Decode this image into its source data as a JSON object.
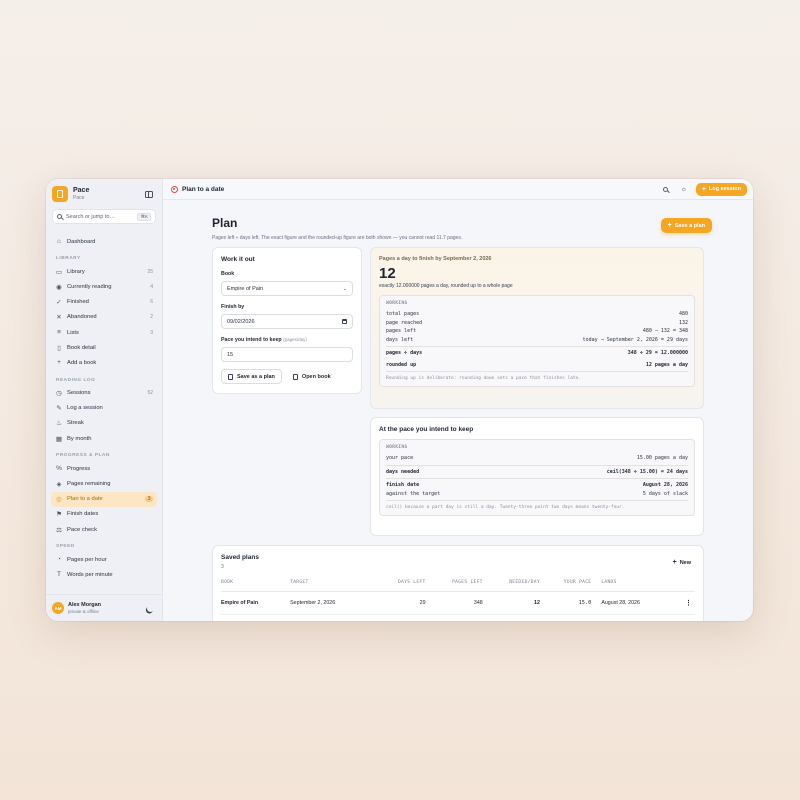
{
  "app": {
    "name": "Pace",
    "subtitle": "Pace"
  },
  "search": {
    "placeholder": "Search or jump to…",
    "shortcut": "⌘K"
  },
  "nav": {
    "dashboard": "Dashboard",
    "sections": [
      {
        "title": "LIBRARY",
        "items": [
          {
            "label": "Library",
            "count": "25",
            "icon": "book-icon"
          },
          {
            "label": "Currently reading",
            "count": "4",
            "icon": "eye-icon"
          },
          {
            "label": "Finished",
            "count": "6",
            "icon": "check-icon"
          },
          {
            "label": "Abandoned",
            "count": "2",
            "icon": "x-icon"
          },
          {
            "label": "Lists",
            "count": "3",
            "icon": "list-icon"
          },
          {
            "label": "Book detail",
            "count": "",
            "icon": "file-icon"
          },
          {
            "label": "Add a book",
            "count": "",
            "icon": "plus-icon"
          }
        ]
      },
      {
        "title": "READING LOG",
        "items": [
          {
            "label": "Sessions",
            "count": "52",
            "icon": "clock-icon"
          },
          {
            "label": "Log a session",
            "count": "",
            "icon": "pencil-icon"
          },
          {
            "label": "Streak",
            "count": "",
            "icon": "flame-icon"
          },
          {
            "label": "By month",
            "count": "",
            "icon": "calendar-icon"
          }
        ]
      },
      {
        "title": "PROGRESS & PLAN",
        "items": [
          {
            "label": "Progress",
            "count": "",
            "icon": "percent-icon"
          },
          {
            "label": "Pages remaining",
            "count": "",
            "icon": "layers-icon"
          },
          {
            "label": "Plan to a date",
            "count": "3",
            "icon": "target-icon",
            "active": true
          },
          {
            "label": "Finish dates",
            "count": "",
            "icon": "flag-icon"
          },
          {
            "label": "Pace check",
            "count": "",
            "icon": "scale-icon"
          }
        ]
      },
      {
        "title": "SPEED",
        "items": [
          {
            "label": "Pages per hour",
            "count": "",
            "icon": "gauge-icon"
          },
          {
            "label": "Words per minute",
            "count": "",
            "icon": "text-icon"
          }
        ]
      }
    ]
  },
  "user": {
    "initials": "AM",
    "name": "Alex Morgan",
    "status": "private & offline"
  },
  "topbar": {
    "title": "Plan to a date",
    "log_label": "Log session"
  },
  "page": {
    "title": "Plan",
    "subtitle": "Pages left ÷ days left. The exact figure and the rounded-up figure are both shown — you cannot read 11.7 pages.",
    "save_label": "Save a plan"
  },
  "form": {
    "title": "Work it out",
    "book_label": "Book",
    "book_value": "Empire of Pain",
    "finish_label": "Finish by",
    "finish_value": "09/02/2026",
    "pace_label": "Pace you intend to keep",
    "pace_hint": "(pages/day)",
    "pace_value": "15",
    "save_btn": "Save as a plan",
    "open_btn": "Open book"
  },
  "result": {
    "heading": "Pages a day to finish by September 2, 2026",
    "value": "12",
    "detail": "exactly 12.000000 pages a day, rounded up to a whole page",
    "working_label": "WORKING",
    "rows": [
      {
        "k": "total pages",
        "v": "480"
      },
      {
        "k": "page reached",
        "v": "132"
      },
      {
        "k": "pages left",
        "v": "480 − 132 = 348"
      },
      {
        "k": "days left",
        "v": "today → September 2, 2026 = 29 days"
      }
    ],
    "rows2": [
      {
        "k": "pages ÷ days",
        "v": "348 ÷ 29 = 12.000000"
      },
      {
        "k": "rounded up",
        "v": "12 pages a day"
      }
    ],
    "note": "Rounding up is deliberate: rounding down sets a pace that finishes late."
  },
  "pace": {
    "title": "At the pace you intend to keep",
    "working_label": "WORKING",
    "r1": {
      "k": "your pace",
      "v": "15.00 pages a day"
    },
    "r2": {
      "k": "days needed",
      "v": "ceil(348 ÷ 15.00) = 24 days"
    },
    "r3": {
      "k": "finish date",
      "v": "August 28, 2026"
    },
    "r4": {
      "k": "against the target",
      "v": "5 days of slack"
    },
    "note": "ceil() because a part day is still a day. Twenty-three point two days means twenty-four."
  },
  "saved": {
    "title": "Saved plans",
    "count": "3",
    "new_label": "New",
    "columns": [
      "BOOK",
      "TARGET",
      "DAYS LEFT",
      "PAGES LEFT",
      "NEEDED/DAY",
      "YOUR PACE",
      "LANDS"
    ],
    "rows": [
      {
        "book": "Empire of Pain",
        "target": "September 2, 2026",
        "days": "29",
        "pages": "348",
        "needed": "12",
        "pace": "15.0",
        "lands": "August 28, 2026"
      }
    ]
  },
  "colors": {
    "accent": "#f5a623",
    "active_bg": "#fde6c4"
  }
}
